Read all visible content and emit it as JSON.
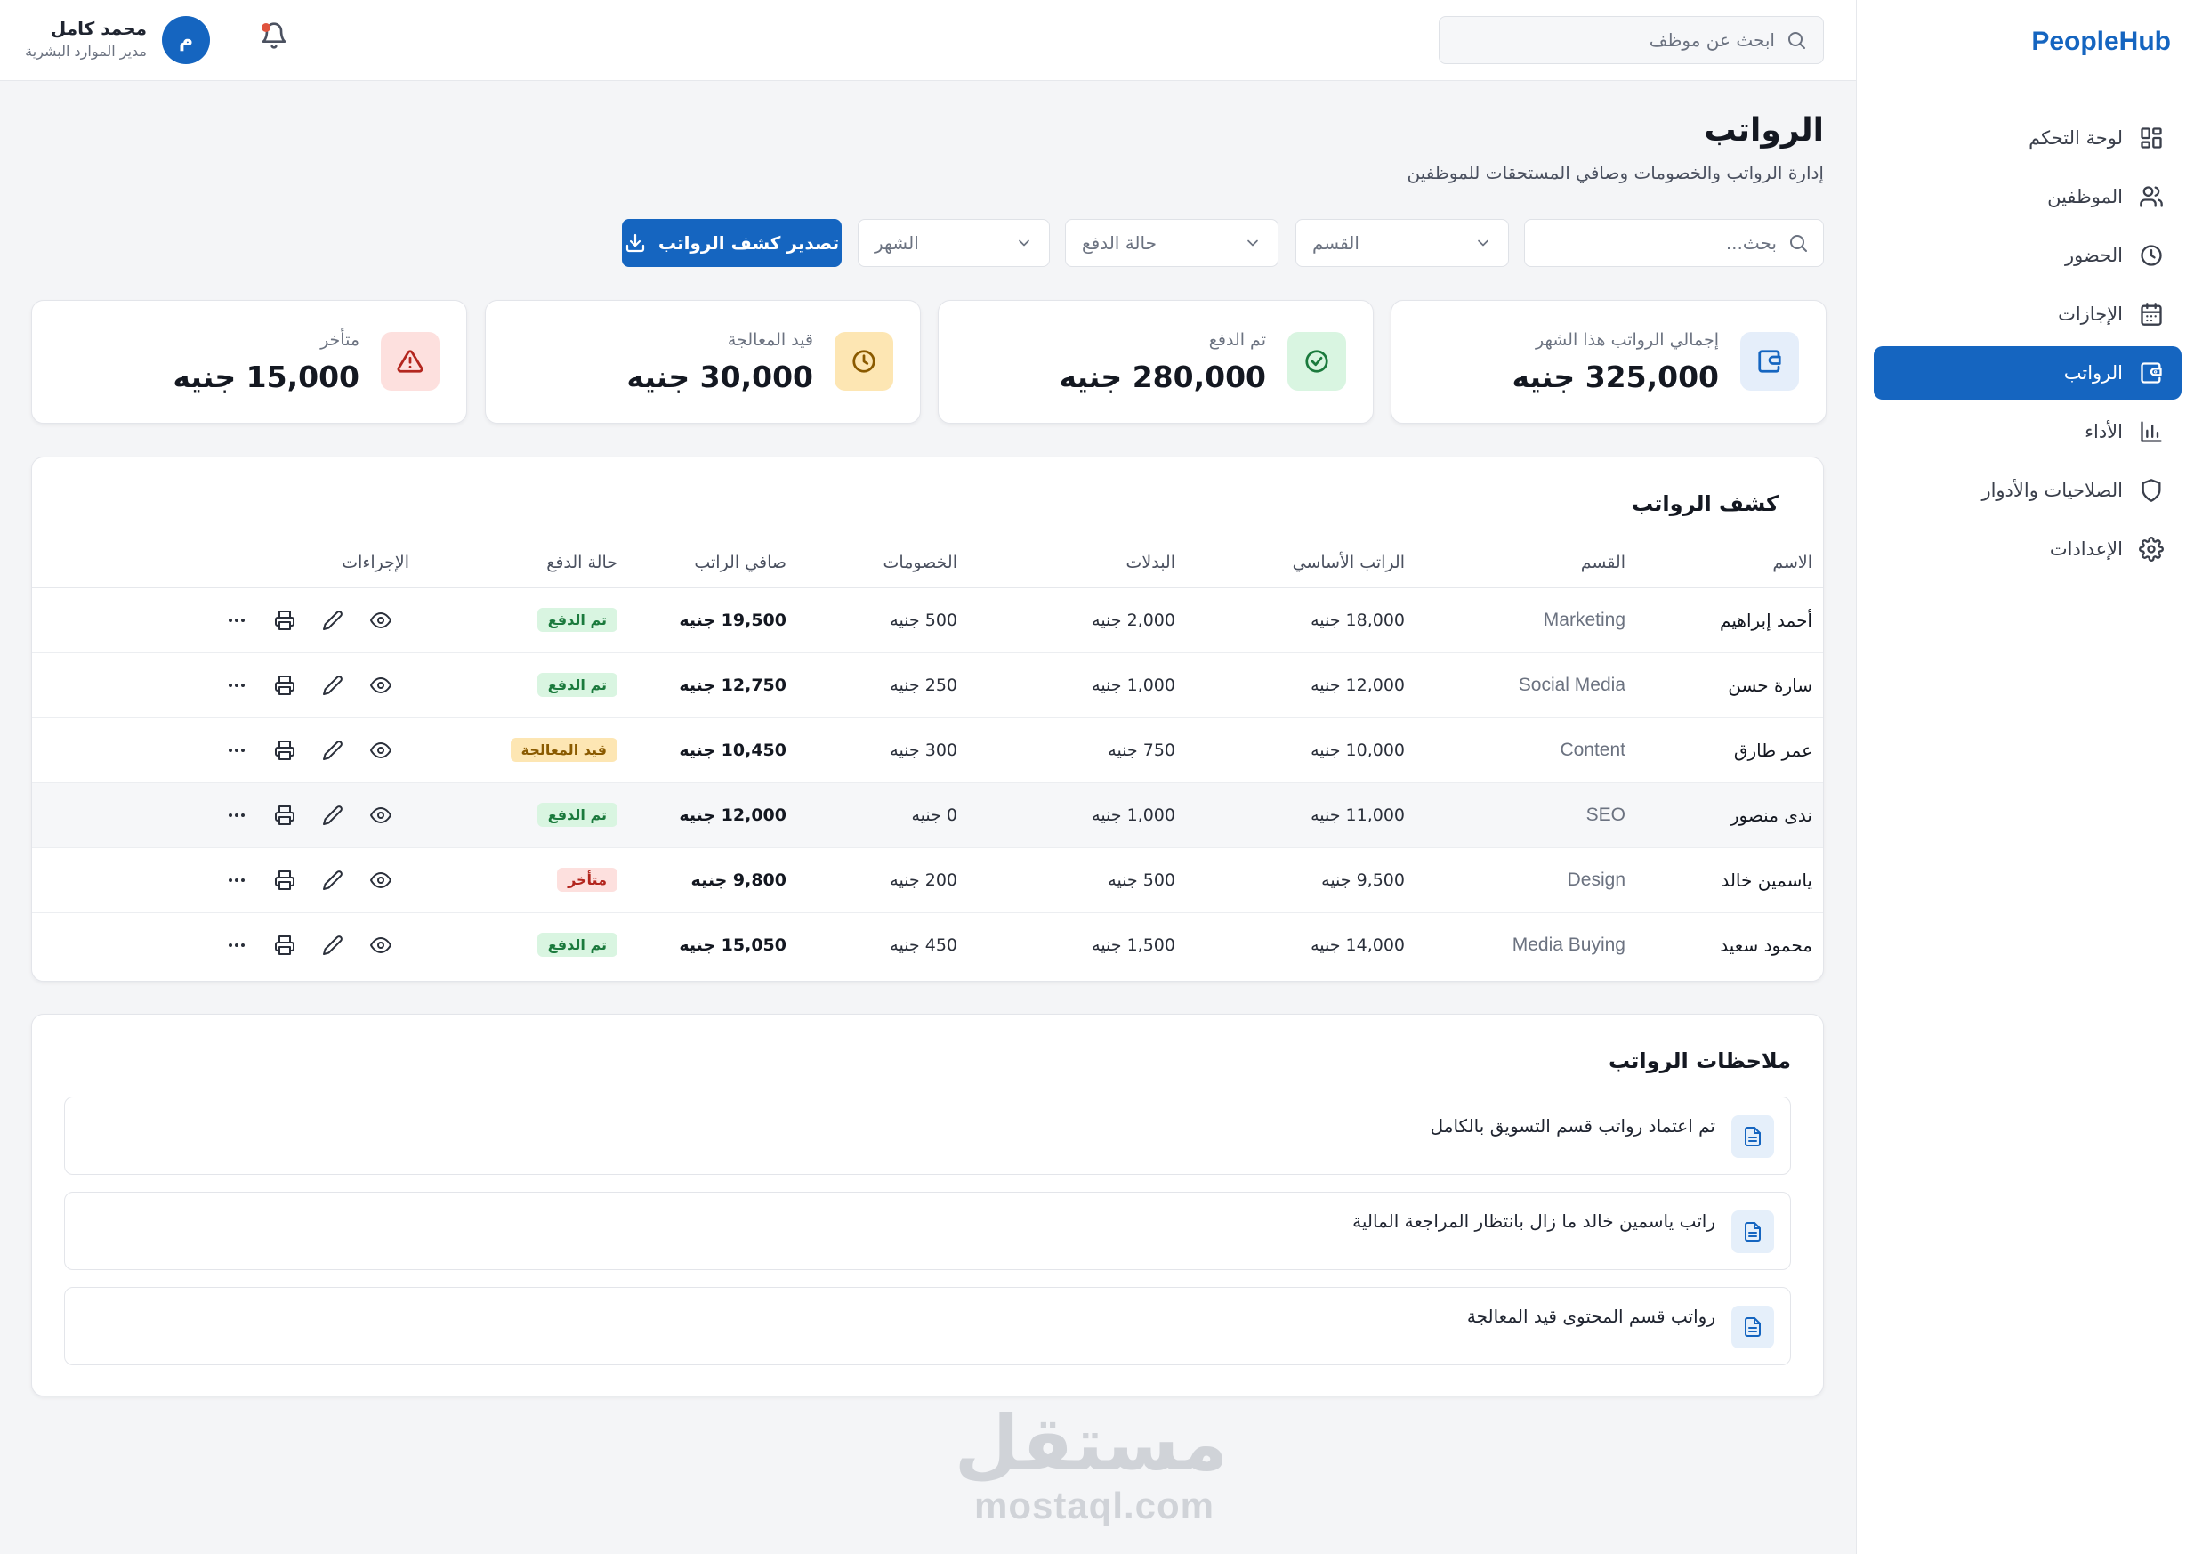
{
  "brand": "PeopleHub",
  "header": {
    "search_placeholder": "ابحث عن موظف",
    "user_name": "محمد كامل",
    "user_role": "مدير الموارد البشرية",
    "avatar_initial": "م"
  },
  "sidebar": {
    "items": [
      {
        "label": "لوحة التحكم",
        "icon": "dashboard-icon"
      },
      {
        "label": "الموظفين",
        "icon": "users-icon"
      },
      {
        "label": "الحضور",
        "icon": "clock-icon"
      },
      {
        "label": "الإجازات",
        "icon": "calendar-icon"
      },
      {
        "label": "الرواتب",
        "icon": "wallet-icon",
        "active": true
      },
      {
        "label": "الأداء",
        "icon": "chart-icon"
      },
      {
        "label": "الصلاحيات والأدوار",
        "icon": "shield-icon"
      },
      {
        "label": "الإعدادات",
        "icon": "gear-icon"
      }
    ]
  },
  "page": {
    "title": "الرواتب",
    "subtitle": "إدارة الرواتب والخصومات وصافي المستحقات للموظفين"
  },
  "filters": {
    "search_placeholder": "بحث...",
    "department": "القسم",
    "payment_status": "حالة الدفع",
    "month": "الشهر",
    "export_label": "تصدير كشف الرواتب"
  },
  "stats": [
    {
      "label": "إجمالي الرواتب هذا الشهر",
      "value": "325,000 جنيه",
      "icon": "wallet-icon",
      "bg": "#e5eefa",
      "fg": "#1565c0"
    },
    {
      "label": "تم الدفع",
      "value": "280,000 جنيه",
      "icon": "check-circle-icon",
      "bg": "#d9f5e1",
      "fg": "#1b7a3d"
    },
    {
      "label": "قيد المعالجة",
      "value": "30,000 جنيه",
      "icon": "clock-icon",
      "bg": "#fde6b3",
      "fg": "#8a5a00"
    },
    {
      "label": "متأخر",
      "value": "15,000 جنيه",
      "icon": "warning-icon",
      "bg": "#fde0de",
      "fg": "#b3261e"
    }
  ],
  "table": {
    "title": "كشف الرواتب",
    "columns": [
      "الاسم",
      "القسم",
      "الراتب الأساسي",
      "البدلات",
      "الخصومات",
      "صافي الراتب",
      "حالة الدفع",
      "الإجراءات"
    ],
    "rows": [
      {
        "name": "أحمد إبراهيم",
        "dept": "Marketing",
        "base": "18,000 جنيه",
        "allow": "2,000 جنيه",
        "deduct": "500 جنيه",
        "net": "19,500 جنيه",
        "status": "تم الدفع",
        "kind": "paid"
      },
      {
        "name": "سارة حسن",
        "dept": "Social Media",
        "base": "12,000 جنيه",
        "allow": "1,000 جنيه",
        "deduct": "250 جنيه",
        "net": "12,750 جنيه",
        "status": "تم الدفع",
        "kind": "paid"
      },
      {
        "name": "عمر طارق",
        "dept": "Content",
        "base": "10,000 جنيه",
        "allow": "750 جنيه",
        "deduct": "300 جنيه",
        "net": "10,450 جنيه",
        "status": "قيد المعالجة",
        "kind": "pending"
      },
      {
        "name": "ندى منصور",
        "dept": "SEO",
        "base": "11,000 جنيه",
        "allow": "1,000 جنيه",
        "deduct": "0 جنيه",
        "net": "12,000 جنيه",
        "status": "تم الدفع",
        "kind": "paid"
      },
      {
        "name": "ياسمين خالد",
        "dept": "Design",
        "base": "9,500 جنيه",
        "allow": "500 جنيه",
        "deduct": "200 جنيه",
        "net": "9,800 جنيه",
        "status": "متأخر",
        "kind": "late"
      },
      {
        "name": "محمود سعيد",
        "dept": "Media Buying",
        "base": "14,000 جنيه",
        "allow": "1,500 جنيه",
        "deduct": "450 جنيه",
        "net": "15,050 جنيه",
        "status": "تم الدفع",
        "kind": "paid"
      }
    ]
  },
  "notes": {
    "title": "ملاحظات الرواتب",
    "items": [
      "تم اعتماد رواتب قسم التسويق بالكامل",
      "راتب ياسمين خالد ما زال بانتظار المراجعة المالية",
      "رواتب قسم المحتوى قيد المعالجة"
    ]
  },
  "watermark": {
    "ar": "مستقل",
    "en": "mostaql.com"
  }
}
